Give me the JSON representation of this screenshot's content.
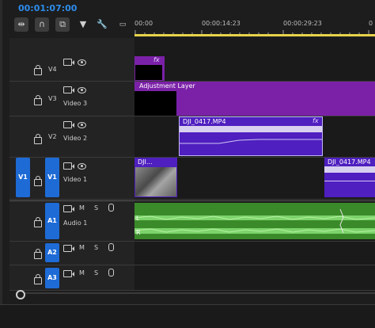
{
  "timecode": "00:01:07:00",
  "ruler": {
    "ticks": [
      "00:00",
      "00:00:14:23",
      "00:00:29:23",
      "0"
    ]
  },
  "tracks": {
    "v4": {
      "label": "V4",
      "name": ""
    },
    "v3": {
      "label": "V3",
      "name": "Video 3"
    },
    "v2": {
      "label": "V2",
      "name": "Video 2"
    },
    "v1": {
      "label": "V1",
      "name": "Video 1",
      "source": "V1"
    },
    "a1": {
      "label": "A1",
      "name": "Audio 1"
    },
    "a2": {
      "label": "A2",
      "name": ""
    },
    "a3": {
      "label": "A3",
      "name": ""
    }
  },
  "audio_controls": {
    "mute": "M",
    "solo": "S"
  },
  "clips": {
    "v4_fx": "fx",
    "adjustment_layer": "Adjustment Layer",
    "v2_clip": "DJI_0417.MP4",
    "v2_fx": "fx",
    "v1_clip_a": "DJI...",
    "v1_clip_b": "DJI_0417.MP4",
    "audio_l": "L",
    "audio_r": "R"
  },
  "colors": {
    "accent": "#1e6bd6",
    "clip_purple": "#7b21a8",
    "clip_violet": "#4f1fbf",
    "audio_green": "#3b8a2a",
    "ruler_yellow": "#e6d24a"
  }
}
